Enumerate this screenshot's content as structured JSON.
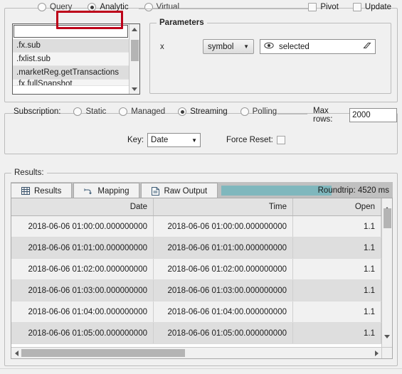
{
  "top": {
    "modes": [
      {
        "label": "Query",
        "selected": false
      },
      {
        "label": "Analytic",
        "selected": true
      },
      {
        "label": "Virtual",
        "selected": false
      }
    ],
    "checkboxes": [
      {
        "label": "Pivot",
        "checked": false
      },
      {
        "label": "Update",
        "checked": false
      }
    ],
    "highlight_color": "#bd0019",
    "highlight_target": "Analytic"
  },
  "browser": {
    "filter_value": "",
    "filter_placeholder": "",
    "items": [
      ".fx.sub",
      ".fxlist.sub",
      ".marketReg.getTransactions",
      ".fx.fullSnapshot"
    ],
    "scroll_up_icon": "triangle-up-icon",
    "scroll_down_icon": "triangle-down-icon"
  },
  "parameters": {
    "legend": "Parameters",
    "rows": [
      {
        "name": "x",
        "type": "symbol",
        "value": "selected",
        "eye_icon": "eye-icon",
        "clear_icon": "eraser-icon"
      }
    ]
  },
  "subscription": {
    "label": "Subscription:",
    "modes": [
      {
        "label": "Static",
        "selected": false
      },
      {
        "label": "Managed",
        "selected": false
      },
      {
        "label": "Streaming",
        "selected": true
      },
      {
        "label": "Polling",
        "selected": false
      }
    ],
    "max_rows_label": "Max rows:",
    "max_rows_value": "2000",
    "key_label": "Key:",
    "key_value": "Date",
    "force_reset_label": "Force Reset:",
    "force_reset_checked": false
  },
  "results": {
    "legend": "Results:",
    "tabs": [
      {
        "label": "Results",
        "icon": "table-grid-icon",
        "active": true
      },
      {
        "label": "Mapping",
        "icon": "mapping-arrow-icon",
        "active": false
      },
      {
        "label": "Raw Output",
        "icon": "document-icon",
        "active": false
      }
    ],
    "roundtrip_text": "Roundtrip: 4520 ms",
    "roundtrip_ms": 4520,
    "progress_color": "#7fb7bd",
    "table": {
      "columns": [
        "Date",
        "Time",
        "Open"
      ],
      "rows": [
        [
          "2018-06-06 01:00:00.000000000",
          "2018-06-06 01:00:00.000000000",
          "1.1"
        ],
        [
          "2018-06-06 01:01:00.000000000",
          "2018-06-06 01:01:00.000000000",
          "1.1"
        ],
        [
          "2018-06-06 01:02:00.000000000",
          "2018-06-06 01:02:00.000000000",
          "1.1"
        ],
        [
          "2018-06-06 01:03:00.000000000",
          "2018-06-06 01:03:00.000000000",
          "1.1"
        ],
        [
          "2018-06-06 01:04:00.000000000",
          "2018-06-06 01:04:00.000000000",
          "1.1"
        ],
        [
          "2018-06-06 01:05:00.000000000",
          "2018-06-06 01:05:00.000000000",
          "1.1"
        ]
      ]
    }
  }
}
